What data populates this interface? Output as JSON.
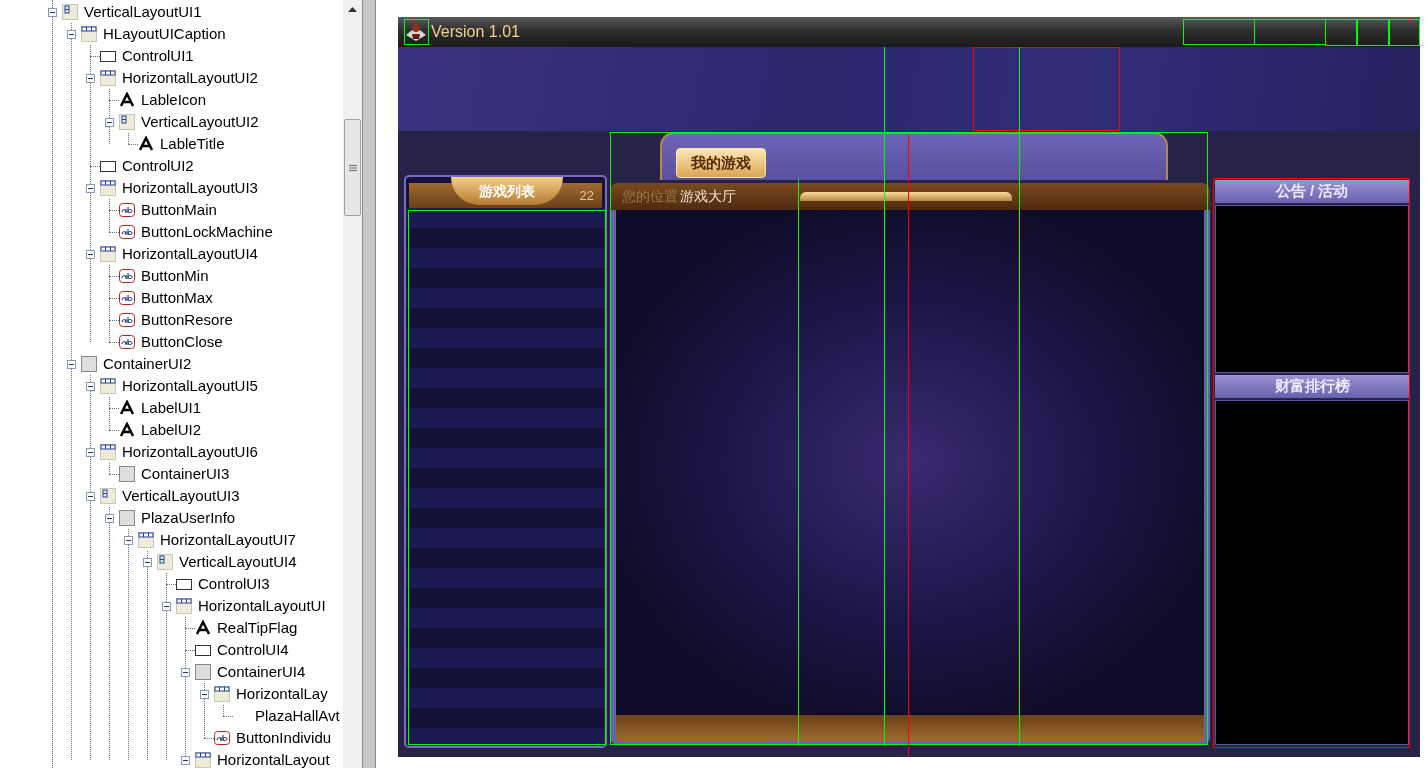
{
  "tree": [
    {
      "kind": "vertical",
      "label": "VerticalLayoutUI1",
      "expanded": true,
      "children": [
        {
          "kind": "horizontal",
          "label": "HLayoutUICaption",
          "expanded": true,
          "children": [
            {
              "kind": "control",
              "label": "ControlUI1"
            },
            {
              "kind": "horizontal",
              "label": "HorizontalLayoutUI2",
              "expanded": true,
              "children": [
                {
                  "kind": "label",
                  "label": "LableIcon"
                },
                {
                  "kind": "vertical",
                  "label": "VerticalLayoutUI2",
                  "expanded": true,
                  "children": [
                    {
                      "kind": "label",
                      "label": "LableTitle"
                    }
                  ]
                }
              ]
            },
            {
              "kind": "control",
              "label": "ControlUI2"
            },
            {
              "kind": "horizontal",
              "label": "HorizontalLayoutUI3",
              "expanded": true,
              "children": [
                {
                  "kind": "button",
                  "label": "ButtonMain"
                },
                {
                  "kind": "button",
                  "label": "ButtonLockMachine"
                }
              ]
            },
            {
              "kind": "horizontal",
              "label": "HorizontalLayoutUI4",
              "expanded": true,
              "children": [
                {
                  "kind": "button",
                  "label": "ButtonMin"
                },
                {
                  "kind": "button",
                  "label": "ButtonMax"
                },
                {
                  "kind": "button",
                  "label": "ButtonResore"
                },
                {
                  "kind": "button",
                  "label": "ButtonClose"
                }
              ]
            }
          ]
        },
        {
          "kind": "container",
          "label": "ContainerUI2",
          "expanded": true,
          "children": [
            {
              "kind": "horizontal",
              "label": "HorizontalLayoutUI5",
              "expanded": true,
              "children": [
                {
                  "kind": "label",
                  "label": "LabelUI1"
                },
                {
                  "kind": "label",
                  "label": "LabelUI2"
                }
              ]
            },
            {
              "kind": "horizontal",
              "label": "HorizontalLayoutUI6",
              "expanded": true,
              "children": [
                {
                  "kind": "container",
                  "label": "ContainerUI3"
                }
              ]
            },
            {
              "kind": "vertical",
              "label": "VerticalLayoutUI3",
              "expanded": true,
              "children": [
                {
                  "kind": "container",
                  "label": "PlazaUserInfo",
                  "expanded": true,
                  "children": [
                    {
                      "kind": "horizontal",
                      "label": "HorizontalLayoutUI7",
                      "expanded": true,
                      "children": [
                        {
                          "kind": "vertical",
                          "label": "VerticalLayoutUI4",
                          "expanded": true,
                          "children": [
                            {
                              "kind": "control",
                              "label": "ControlUI3"
                            },
                            {
                              "kind": "horizontal",
                              "label": "HorizontalLayoutUI",
                              "expanded": true,
                              "children": [
                                {
                                  "kind": "label",
                                  "label": "RealTipFlag"
                                },
                                {
                                  "kind": "control",
                                  "label": "ControlUI4"
                                },
                                {
                                  "kind": "container",
                                  "label": "ContainerUI4",
                                  "expanded": true,
                                  "children": [
                                    {
                                      "kind": "horizontal",
                                      "label": "HorizontalLay",
                                      "expanded": true,
                                      "children": [
                                        {
                                          "label": "PlazaHallAvt"
                                        }
                                      ]
                                    },
                                    {
                                      "kind": "button",
                                      "label": "ButtonIndividu"
                                    }
                                  ]
                                },
                                {
                                  "kind": "horizontal",
                                  "label": "HorizontalLayout",
                                  "expanded": true
                                }
                              ]
                            }
                          ]
                        }
                      ]
                    }
                  ]
                }
              ]
            }
          ]
        }
      ]
    }
  ],
  "preview": {
    "title": "Version 1.01",
    "game_list": {
      "title": "游戏列表",
      "count": "22"
    },
    "tabs": [
      {
        "label": "我的游戏",
        "selected": true
      }
    ],
    "location": {
      "label": "您的位置",
      "value": "游戏大厅"
    },
    "side_panels": [
      {
        "title": "公告 / 活动"
      },
      {
        "title": "财富排行榜"
      }
    ]
  }
}
